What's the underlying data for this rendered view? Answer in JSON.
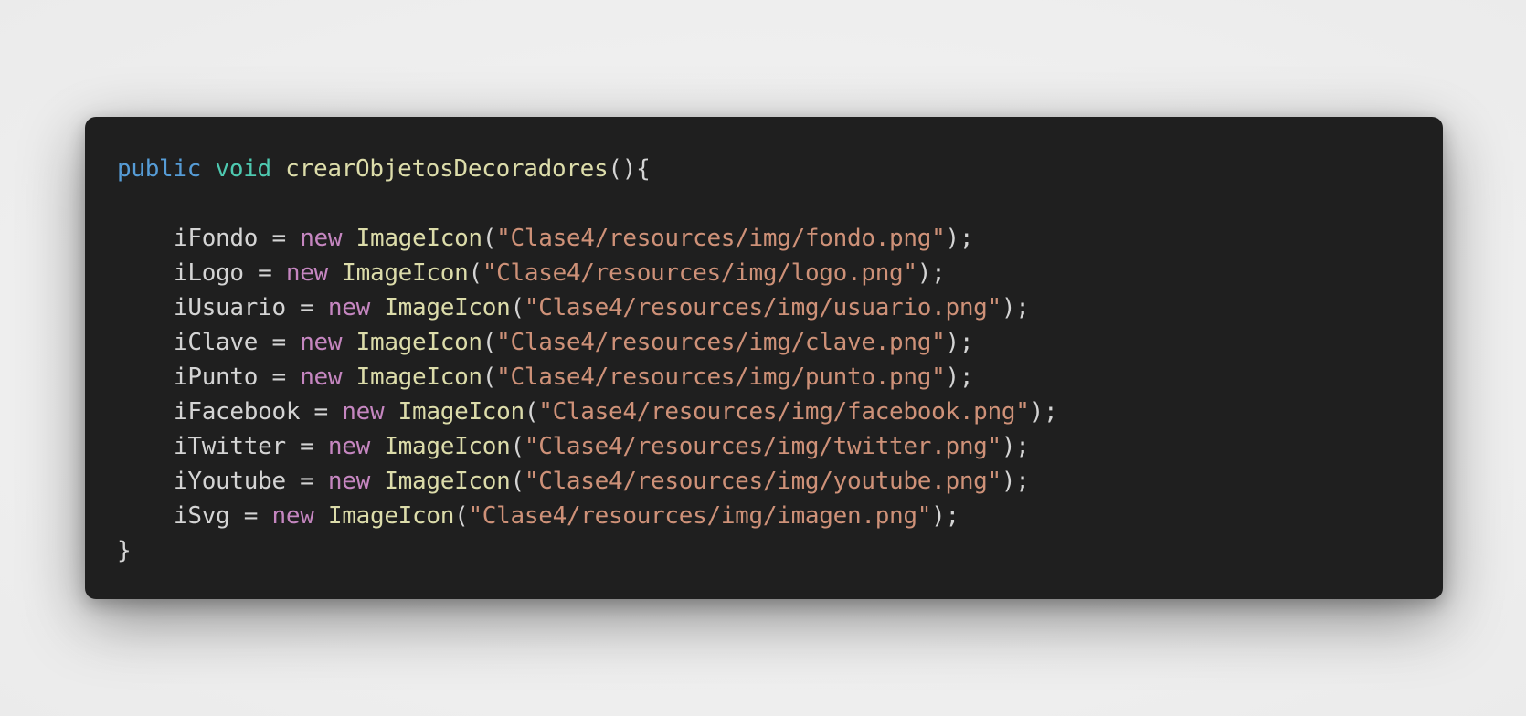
{
  "colors": {
    "background": "#efefef",
    "editor_background": "#1f1f1f",
    "keyword_modifier": "#569cd6",
    "keyword_type": "#4ec9b0",
    "keyword_new": "#c586c0",
    "function_name": "#dcdcaa",
    "string": "#ce9178",
    "plain_text": "#d4d4d4"
  },
  "code": {
    "method_modifier": "public",
    "method_return_type": "void",
    "method_name": "crearObjetosDecoradores",
    "method_open": "(){",
    "method_close": "}",
    "new_keyword": "new",
    "class_name": "ImageIcon",
    "assignments": [
      {
        "variable": "iFondo",
        "path": "\"Clase4/resources/img/fondo.png\""
      },
      {
        "variable": "iLogo",
        "path": "\"Clase4/resources/img/logo.png\""
      },
      {
        "variable": "iUsuario",
        "path": "\"Clase4/resources/img/usuario.png\""
      },
      {
        "variable": "iClave",
        "path": "\"Clase4/resources/img/clave.png\""
      },
      {
        "variable": "iPunto",
        "path": "\"Clase4/resources/img/punto.png\""
      },
      {
        "variable": "iFacebook",
        "path": "\"Clase4/resources/img/facebook.png\""
      },
      {
        "variable": "iTwitter",
        "path": "\"Clase4/resources/img/twitter.png\""
      },
      {
        "variable": "iYoutube",
        "path": "\"Clase4/resources/img/youtube.png\""
      },
      {
        "variable": "iSvg",
        "path": "\"Clase4/resources/img/imagen.png\""
      }
    ]
  }
}
